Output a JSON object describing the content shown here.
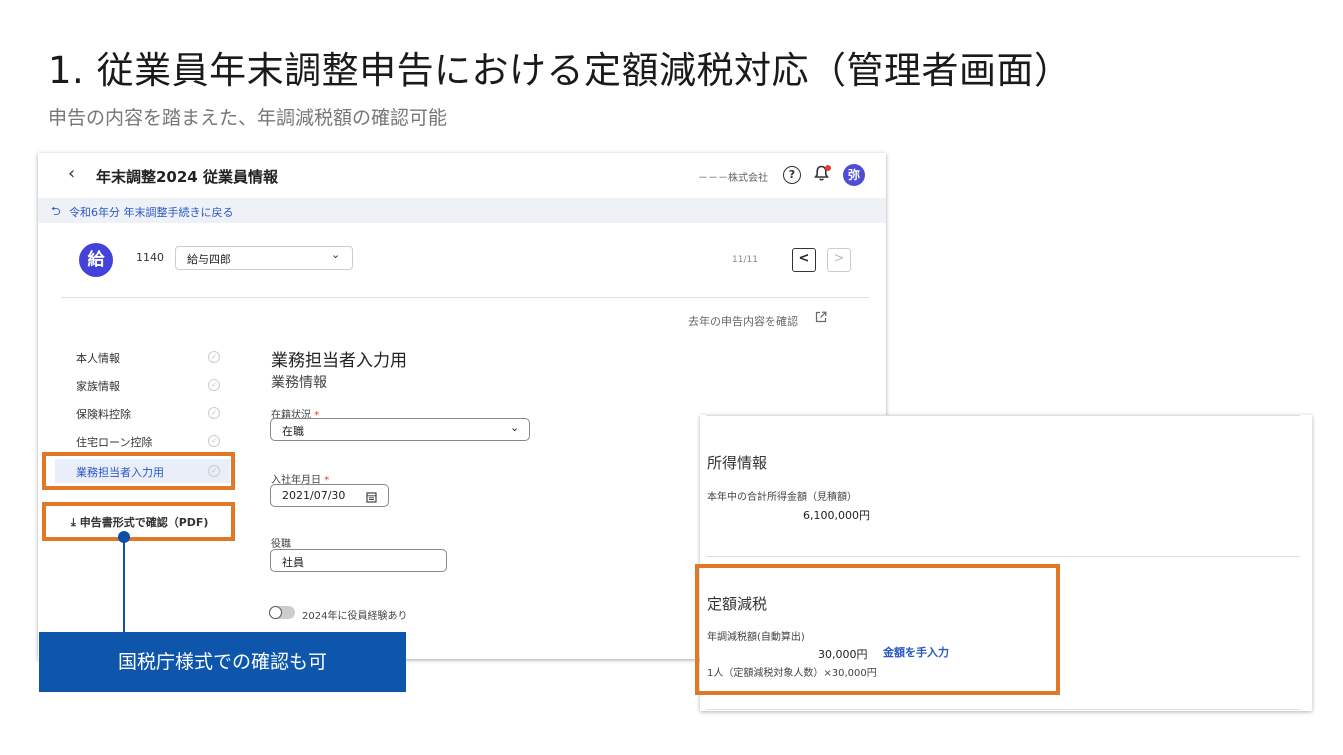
{
  "slide": {
    "title": "1. 従業員年末調整申告における定額減税対応（管理者画面）",
    "subtitle": "申告の内容を踏まえた、年調減税額の確認可能"
  },
  "app": {
    "back_icon": "chevron-left-icon",
    "title": "年末調整2024 従業員情報",
    "company": "－－－株式会社",
    "help_icon": "?",
    "avatar_text": "弥",
    "return_link": "令和6年分 年末調整手続きに戻る"
  },
  "employee": {
    "avatar_text": "給",
    "id": "1140",
    "name": "給与四郎",
    "pager": "11/11",
    "prev_label": "<",
    "next_label": ">"
  },
  "prev_year_link": "去年の申告内容を確認",
  "nav": {
    "items": [
      {
        "label": "本人情報"
      },
      {
        "label": "家族情報"
      },
      {
        "label": "保険料控除"
      },
      {
        "label": "住宅ローン控除"
      },
      {
        "label": "業務担当者入力用"
      }
    ],
    "pdf_label": "申告書形式で確認（PDF)"
  },
  "form": {
    "title": "業務担当者入力用",
    "subtitle": "業務情報",
    "status_label": "在籍状況",
    "status_value": "在職",
    "join_label": "入社年月日",
    "join_value": "2021/07/30",
    "role_label": "役職",
    "role_value": "社員",
    "officer_toggle_label": "2024年に役員経験あり",
    "required_mark": "*"
  },
  "income": {
    "title": "所得情報",
    "total_label": "本年中の合計所得金額（見積額）",
    "total_value": "6,100,000円"
  },
  "tax": {
    "title": "定額減税",
    "auto_label": "年調減税額(自動算出)",
    "amount": "30,000円",
    "manual_link": "金額を手入力",
    "note": "1人（定額減税対象人数）×30,000円"
  },
  "callout": "国税庁様式での確認も可",
  "colors": {
    "accent": "#2a57c8",
    "highlight": "#e07828",
    "callout": "#0d56ab"
  }
}
